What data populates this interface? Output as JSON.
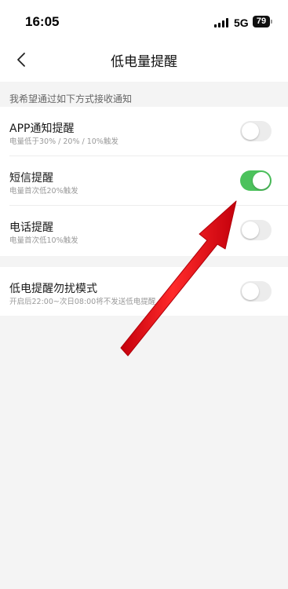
{
  "status_bar": {
    "time": "16:05",
    "network": "5G",
    "battery": "79"
  },
  "nav": {
    "title": "低电量提醒"
  },
  "section": {
    "header": "我希望通过如下方式接收通知"
  },
  "settings": {
    "items": [
      {
        "title": "APP通知提醒",
        "subtitle": "电量低于30% / 20% / 10%触发",
        "enabled": false
      },
      {
        "title": "短信提醒",
        "subtitle": "电量首次低20%触发",
        "enabled": true
      },
      {
        "title": "电话提醒",
        "subtitle": "电量首次低10%触发",
        "enabled": false
      }
    ]
  },
  "dnd": {
    "title": "低电提醒勿扰模式",
    "subtitle": "开启后22:00~次日08:00将不发送低电提醒",
    "enabled": false
  },
  "colors": {
    "toggle_on": "#4cc25c",
    "toggle_off": "#ececec",
    "annotation_arrow": "#e8141b"
  }
}
